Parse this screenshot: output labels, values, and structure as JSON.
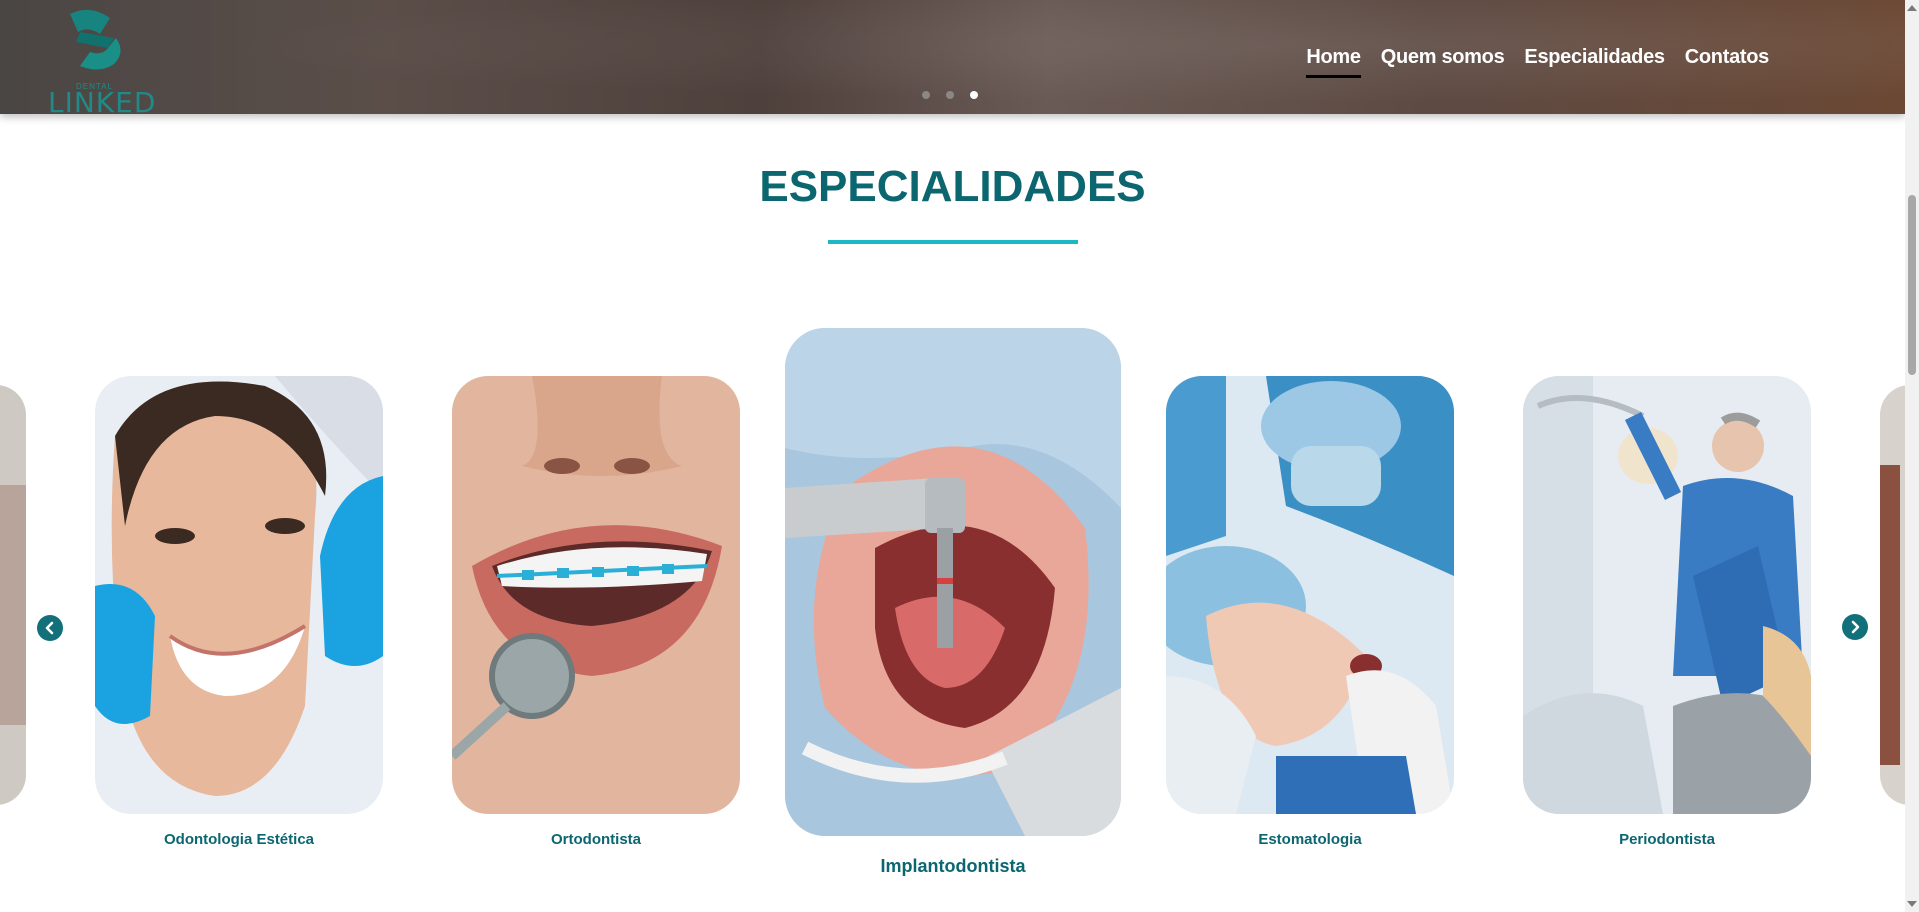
{
  "brand": {
    "small_text": "DENTAL",
    "name": "LINKED",
    "color": "#1f8a88"
  },
  "nav": {
    "items": [
      {
        "label": "Home",
        "active": true
      },
      {
        "label": "Quem somos",
        "active": false
      },
      {
        "label": "Especialidades",
        "active": false
      },
      {
        "label": "Contatos",
        "active": false
      }
    ]
  },
  "hero": {
    "slide_count": 3,
    "active_slide": 3
  },
  "section": {
    "title": "ESPECIALIDADES",
    "accent": "#1cb8c4",
    "title_color": "#0b6670"
  },
  "carousel": {
    "prev_icon": "chevron-left-icon",
    "next_icon": "chevron-right-icon",
    "cards": [
      {
        "label": "Odontologia Estética",
        "image": "smiling-woman-photo"
      },
      {
        "label": "Ortodontista",
        "image": "braces-photo"
      },
      {
        "label": "Implantodontista",
        "image": "dental-implant-photo",
        "featured": true
      },
      {
        "label": "Estomatologia",
        "image": "dental-surgery-photo"
      },
      {
        "label": "Periodontista",
        "image": "dentist-clipboard-photo"
      }
    ]
  }
}
